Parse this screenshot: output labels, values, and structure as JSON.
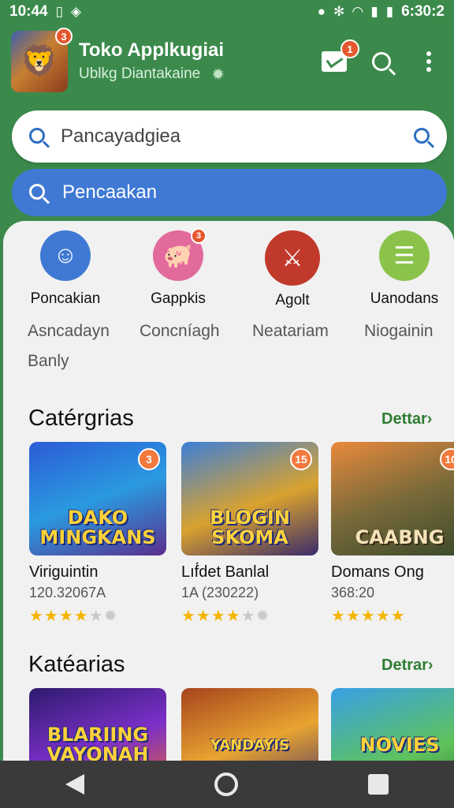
{
  "status_bar": {
    "time": "10:44",
    "clock_right": "6:30:2"
  },
  "header": {
    "title": "Toko Applkugiai",
    "subtitle": "Ublkg Diantakaine",
    "logo_badge": "3",
    "mail_badge": "1"
  },
  "search": {
    "primary_placeholder": "Pancayadgiea",
    "secondary_label": "Pencaakan"
  },
  "categories": [
    {
      "label": "Poncakian",
      "color": "#3f79d4",
      "icon": "box-smile-icon"
    },
    {
      "label": "Gappkis",
      "color": "#e26a9c",
      "icon": "pig-icon",
      "badge": "3"
    },
    {
      "label": "Agolt",
      "color": "#c0392b",
      "icon": "warrior-icon"
    },
    {
      "label": "Uanodans",
      "color": "#8bc34a",
      "icon": "list-icon"
    }
  ],
  "subcategories": [
    "Asncadayn",
    "Concníagh",
    "Neatariam",
    "Niogainin",
    "Banly"
  ],
  "section1": {
    "title": "Catérgrias",
    "more": "Dettar",
    "cards": [
      {
        "art": "DAKO MINGKANS",
        "badge": "3",
        "name": "Viriguintin",
        "sub": "120.32067A",
        "rating": 4,
        "bg": "linear-gradient(160deg,#2c5bd6,#2a9ae0 50%,#5a2e8c)"
      },
      {
        "art": "BLOGIN SKOMA",
        "badge": "15",
        "name": "Lıf́det Banlal",
        "sub": "1A (230222)",
        "rating": 4,
        "bg": "linear-gradient(160deg,#3d7fd8,#d9a22e 55%,#3a2a6b)"
      },
      {
        "art": "CAABNG",
        "badge": "10",
        "name": "Domans Ong",
        "sub": "368:20",
        "rating": 5,
        "bg": "linear-gradient(160deg,#e98a3c,#7a6a3a 50%,#3a4a2a)"
      }
    ]
  },
  "section2": {
    "title": "Katéarias",
    "more": "Detrar",
    "cards": [
      {
        "art": "BLARIING VAYONAH",
        "bg": "linear-gradient(160deg,#2e1b6d,#7b2fc9 50%,#f06a2a)"
      },
      {
        "art": "YANDAYIS",
        "bg": "linear-gradient(160deg,#a6441d,#e8a431 50%,#3a2a6b)"
      },
      {
        "art": "NOVIES",
        "bg": "linear-gradient(160deg,#39a0e6,#5fc35a 60%,#2d6a3a)"
      }
    ]
  }
}
